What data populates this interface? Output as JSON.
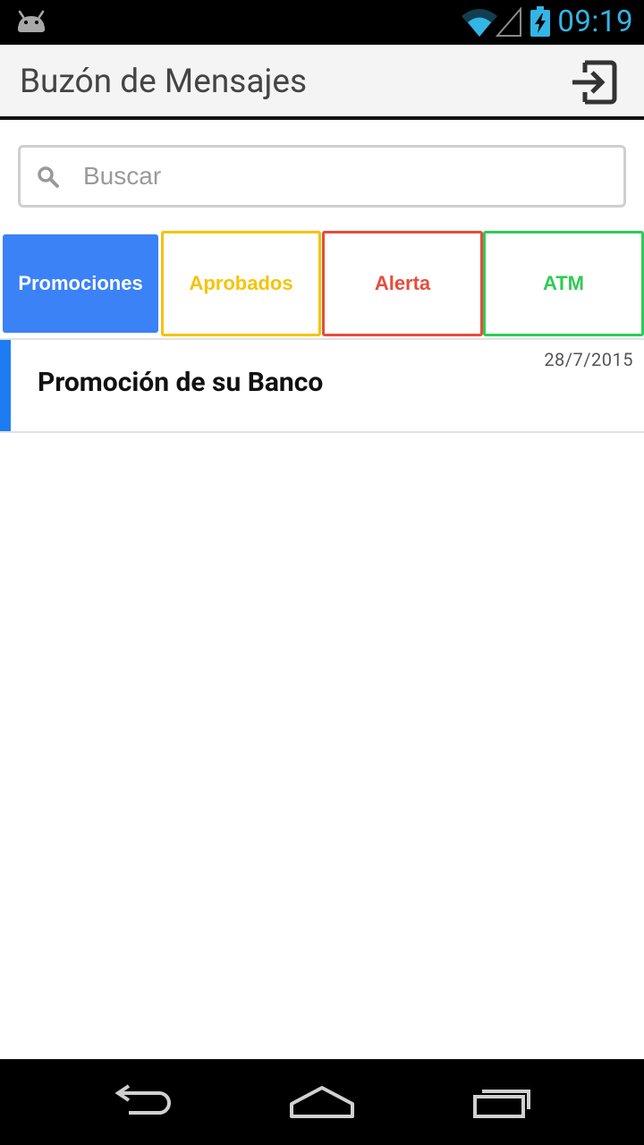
{
  "status_bar": {
    "time": "09:19",
    "icons": [
      "android-icon",
      "wifi-icon",
      "signal-icon",
      "battery-charging-icon"
    ]
  },
  "app_bar": {
    "title": "Buzón de Mensajes",
    "action_icon": "logout-icon"
  },
  "search": {
    "placeholder": "Buscar",
    "value": "",
    "icon": "search-icon"
  },
  "tabs": [
    {
      "label": "Promociones",
      "color": "#3b82f6",
      "selected": true
    },
    {
      "label": "Aprobados",
      "color": "#f5c30a",
      "selected": false
    },
    {
      "label": "Alerta",
      "color": "#e74c3c",
      "selected": false
    },
    {
      "label": "ATM",
      "color": "#2ecc55",
      "selected": false
    }
  ],
  "messages": [
    {
      "title": "Promoción de su Banco",
      "date": "28/7/2015",
      "accent_color": "#1e7cf2"
    }
  ],
  "nav_bar": {
    "icons": [
      "back-icon",
      "home-icon",
      "recents-icon"
    ]
  }
}
